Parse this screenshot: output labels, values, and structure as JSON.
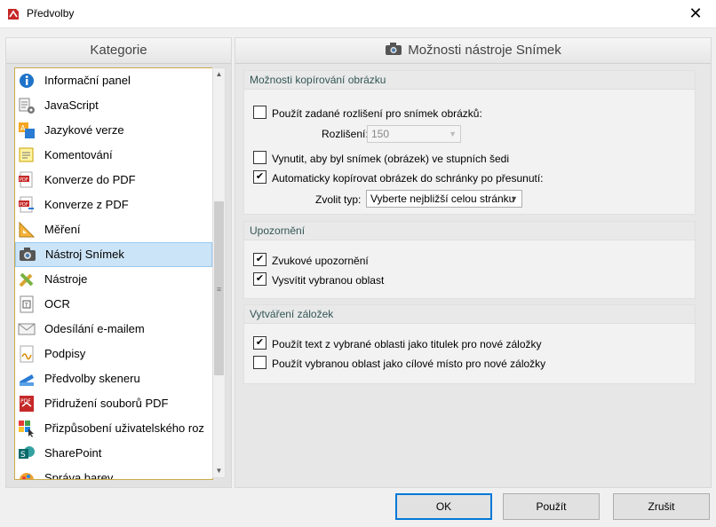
{
  "window": {
    "title": "Předvolby",
    "close_glyph": "✕"
  },
  "left_panel": {
    "heading": "Kategorie",
    "items": [
      {
        "label": "Informační panel",
        "icon": "info-icon"
      },
      {
        "label": "JavaScript",
        "icon": "script-gear-icon"
      },
      {
        "label": "Jazykové verze",
        "icon": "language-icon"
      },
      {
        "label": "Komentování",
        "icon": "comment-icon"
      },
      {
        "label": "Konverze do PDF",
        "icon": "pdf-convert-icon"
      },
      {
        "label": "Konverze z PDF",
        "icon": "pdf-export-icon"
      },
      {
        "label": "Měření",
        "icon": "ruler-triangle-icon"
      },
      {
        "label": "Nástroj Snímek",
        "icon": "camera-icon"
      },
      {
        "label": "Nástroje",
        "icon": "tools-icon"
      },
      {
        "label": "OCR",
        "icon": "ocr-icon"
      },
      {
        "label": "Odesílání e-mailem",
        "icon": "envelope-icon"
      },
      {
        "label": "Podpisy",
        "icon": "signature-icon"
      },
      {
        "label": "Předvolby skeneru",
        "icon": "scanner-icon"
      },
      {
        "label": "Přidružení souborů PDF",
        "icon": "pdf-file-icon"
      },
      {
        "label": "Přizpůsobení uživatelského roz",
        "icon": "customize-icon"
      },
      {
        "label": "SharePoint",
        "icon": "sharepoint-icon"
      },
      {
        "label": "Správa barev",
        "icon": "color-icon"
      }
    ],
    "selected_index": 7
  },
  "right_panel": {
    "heading": "Možnosti nástroje Snímek",
    "groups": {
      "copy": {
        "title": "Možnosti kopírování obrázku",
        "use_resolution": {
          "label": "Použít zadané rozlišení pro snímek obrázků:",
          "checked": false
        },
        "resolution_label": "Rozlišení:",
        "resolution_value": "150",
        "grayscale": {
          "label": "Vynutit, aby byl snímek (obrázek) ve stupních šedi",
          "checked": false
        },
        "auto_copy": {
          "label": "Automaticky kopírovat obrázek do schránky po přesunutí:",
          "checked": true
        },
        "type_label": "Zvolit typ:",
        "type_value": "Vyberte nejbližší celou stránku"
      },
      "notify": {
        "title": "Upozornění",
        "sound": {
          "label": "Zvukové upozornění",
          "checked": true
        },
        "highlight": {
          "label": "Vysvítit vybranou oblast",
          "checked": true
        }
      },
      "bookmarks": {
        "title": "Vytváření záložek",
        "text_title": {
          "label": "Použít text z vybrané oblasti jako titulek pro nové záložky",
          "checked": true
        },
        "target": {
          "label": "Použít vybranou oblast jako cílové místo pro nové záložky",
          "checked": false
        }
      }
    }
  },
  "buttons": {
    "ok": "OK",
    "apply": "Použít",
    "cancel": "Zrušit"
  },
  "glyphs": {
    "check": "✔",
    "arrow_down": "▼",
    "arrow_up": "▲",
    "grip": "≡"
  }
}
